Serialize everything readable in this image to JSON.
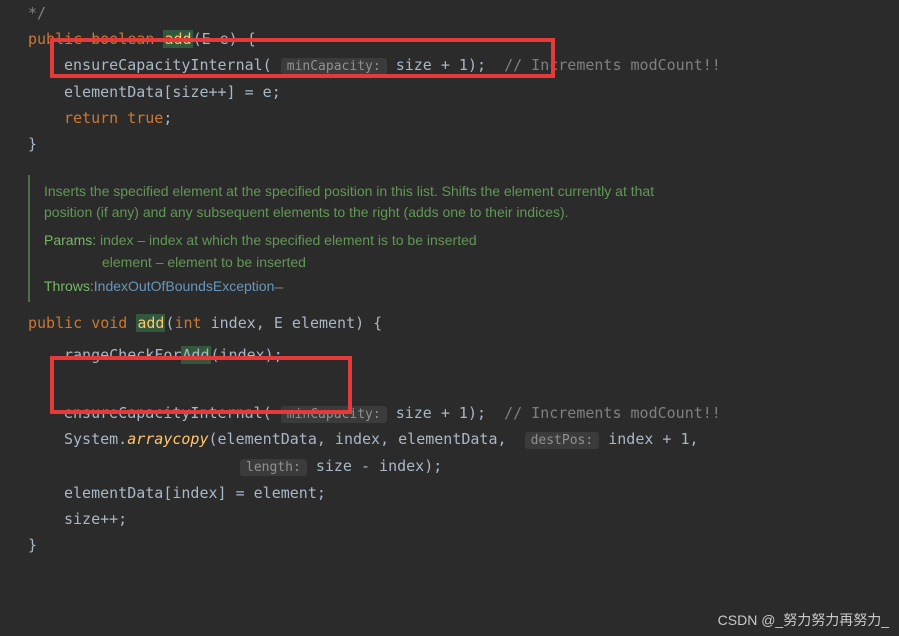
{
  "code": {
    "line0": "*/",
    "sig1": {
      "pub": "public ",
      "bool": "boolean ",
      "add": "add",
      "params": "(E e) {"
    },
    "l2": {
      "call": "ensureCapacityInternal(",
      "hint": "minCapacity:",
      "arg": " size + 1)",
      "semi": ";",
      "cmt": "  // Increments modCount!!"
    },
    "l3": "elementData[size++] = e;",
    "l4": {
      "ret": "return ",
      "tru": "true",
      "semi": ";"
    },
    "l5": "}",
    "jd": {
      "desc1": "Inserts the specified element at the specified position in this list. Shifts the element currently at that",
      "desc2": "position (if any) and any subsequent elements to the right (adds one to their indices).",
      "params_lbl": "Params:",
      "p1": " index – index at which the specified element is to be inserted",
      "p2": "element – element to be inserted",
      "throws_lbl": "Throws:",
      "throws_ex": " IndexOutOfBoundsException ",
      "throws_dash": "–"
    },
    "sig2": {
      "pub": "public ",
      "void": "void ",
      "add": "add",
      "params": "(",
      "int": "int",
      "rest": " index, E element) {"
    },
    "r1": {
      "call": "rangeCheckFor",
      "add": "Add",
      "rest": "(index);"
    },
    "r2": {
      "call": "ensureCapacityInternal(",
      "hint": "minCapacity:",
      "arg": " size + 1);",
      "cmt": "  // Increments modCount!!"
    },
    "r3": {
      "sys": "System.",
      "ac": "arraycopy",
      "args1": "(elementData, index, elementData, ",
      "hint1": "destPos:",
      "args2": " index + 1,"
    },
    "r4": {
      "hint2": "length:",
      "args3": " size - index);"
    },
    "r5": "elementData[index] = element;",
    "r6": "size++;",
    "r7": "}"
  },
  "watermark": "CSDN @_努力努力再努力_"
}
